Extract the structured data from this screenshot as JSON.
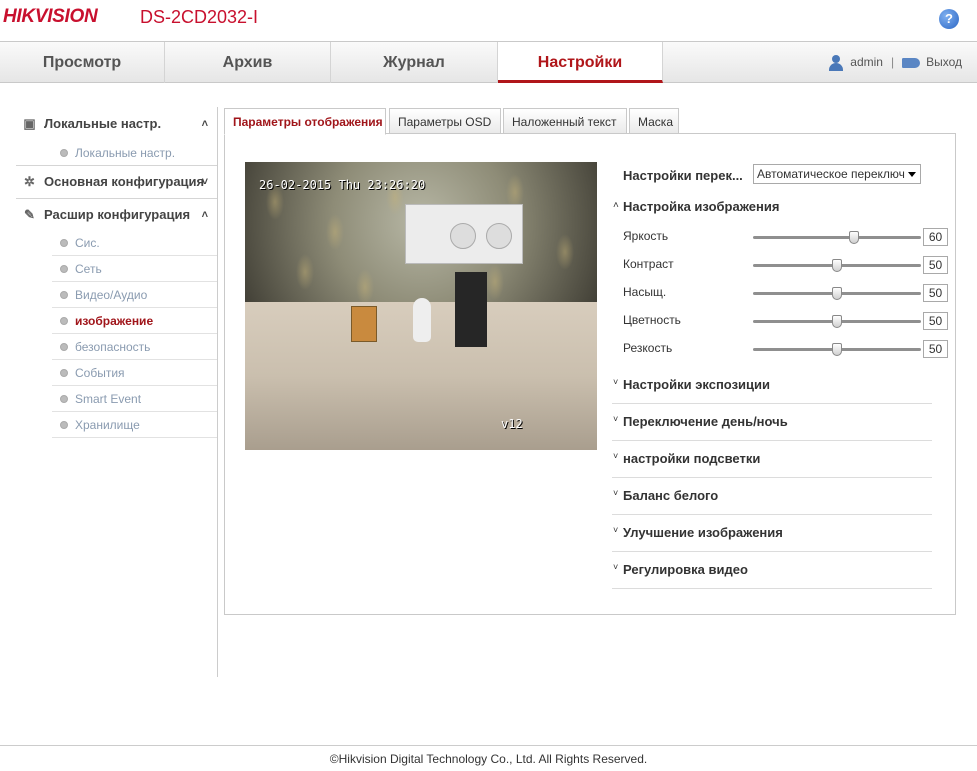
{
  "header": {
    "logo": "HIKVISION",
    "model": "DS-2CD2032-I",
    "help_icon": "?"
  },
  "nav": {
    "tabs": [
      "Просмотр",
      "Архив",
      "Журнал",
      "Настройки"
    ],
    "active": "Настройки",
    "user": "admin",
    "separator": "|",
    "logout": "Выход"
  },
  "sidebar": {
    "sections": [
      {
        "label": "Локальные настр.",
        "arrow": "˄",
        "icon": "monitor-icon",
        "items": [
          "Локальные настр."
        ]
      },
      {
        "label": "Основная конфигурация",
        "arrow": "˅",
        "icon": "gear-icon",
        "items": []
      },
      {
        "label": "Расшир конфигурация",
        "arrow": "˄",
        "icon": "wrench-icon",
        "items": [
          "Сис.",
          "Сеть",
          "Видео/Аудио",
          "изображение",
          "безопасность",
          "События",
          "Smart Event",
          "Хранилище"
        ]
      }
    ],
    "active_item": "изображение"
  },
  "tabs": [
    "Параметры отображения",
    "Параметры OSD",
    "Наложенный текст",
    "Маска"
  ],
  "active_tab": "Параметры отображения",
  "video": {
    "timestamp": "26-02-2015 Thu 23:26:20",
    "channel_label": "v12"
  },
  "settings": {
    "switch_label": "Настройки перек...",
    "switch_value": "Автоматическое переключ",
    "image_section": "Настройка изображения",
    "sliders": [
      {
        "label": "Яркость",
        "value": 60
      },
      {
        "label": "Контраст",
        "value": 50
      },
      {
        "label": "Насыщ.",
        "value": 50
      },
      {
        "label": "Цветность",
        "value": 50
      },
      {
        "label": "Резкость",
        "value": 50
      }
    ],
    "collapsed": [
      "Настройки экспозиции",
      "Переключение день/ночь",
      "настройки подсветки",
      "Баланс белого",
      "Улучшение изображения",
      "Регулировка видео"
    ]
  },
  "footer": "©Hikvision Digital Technology Co., Ltd. All Rights Reserved."
}
